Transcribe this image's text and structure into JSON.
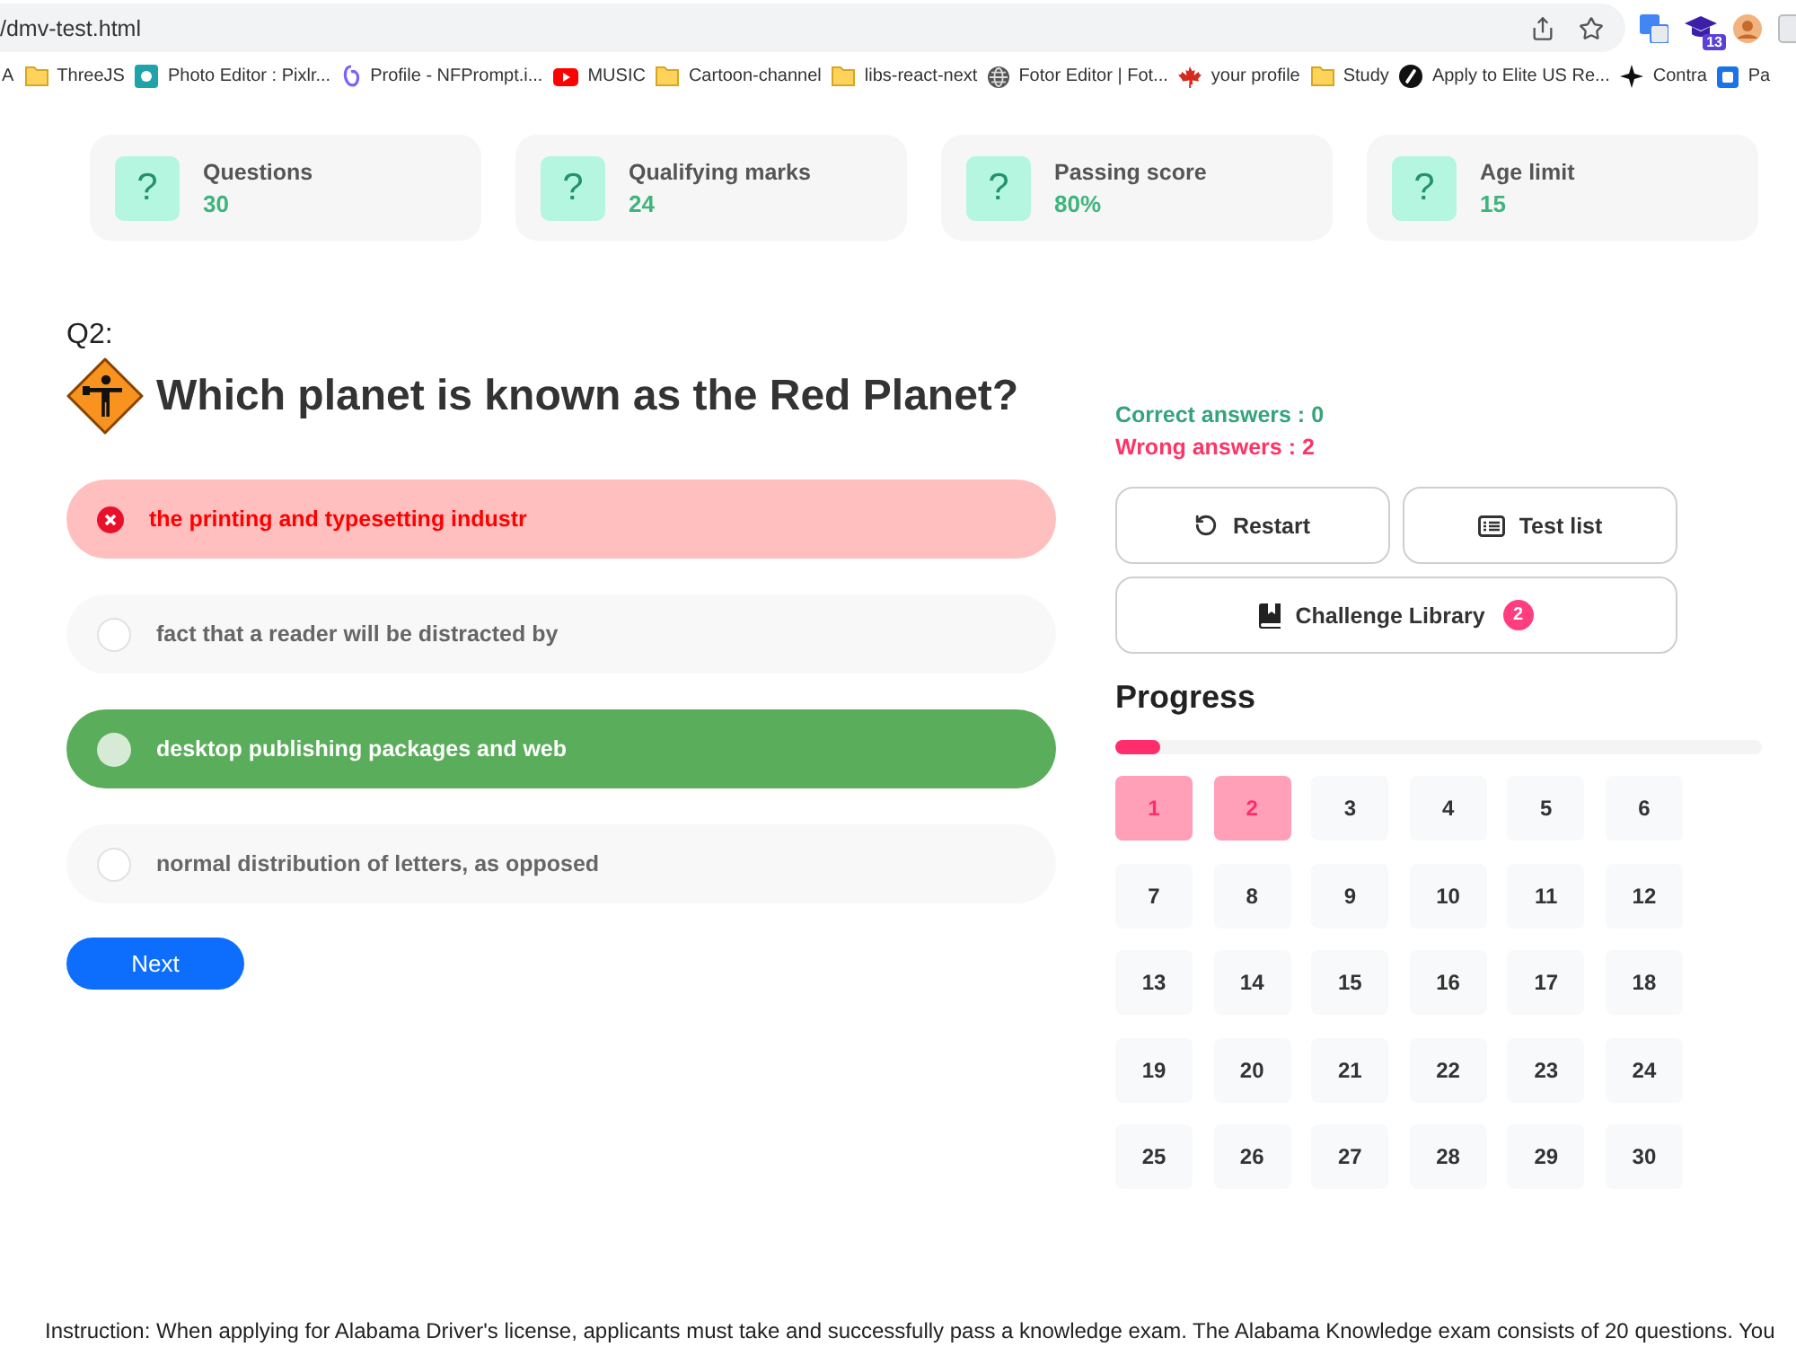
{
  "browser": {
    "url": "/dmv-test.html",
    "extension_badge": "13"
  },
  "bookmarks": [
    {
      "kind": "plain",
      "label": "A"
    },
    {
      "kind": "folder",
      "label": "ThreeJS"
    },
    {
      "kind": "tile",
      "label": "Photo Editor : Pixlr..."
    },
    {
      "kind": "swirl",
      "label": "Profile - NFPrompt.i..."
    },
    {
      "kind": "video",
      "label": "MUSIC"
    },
    {
      "kind": "folder",
      "label": "Cartoon-channel"
    },
    {
      "kind": "folder",
      "label": "libs-react-next"
    },
    {
      "kind": "globe",
      "label": "Fotor Editor | Fot..."
    },
    {
      "kind": "leaf",
      "label": "your profile"
    },
    {
      "kind": "folder",
      "label": "Study"
    },
    {
      "kind": "disc",
      "label": "Apply to Elite US Re..."
    },
    {
      "kind": "diamond",
      "label": "Contra"
    },
    {
      "kind": "square",
      "label": "Pa"
    }
  ],
  "stats": [
    {
      "glyph": "?",
      "label": "Questions",
      "value": "30"
    },
    {
      "glyph": "?",
      "label": "Qualifying marks",
      "value": "24"
    },
    {
      "glyph": "?",
      "label": "Passing score",
      "value": "80%"
    },
    {
      "glyph": "?",
      "label": "Age limit",
      "value": "15"
    }
  ],
  "question": {
    "number": "Q2:",
    "text": "Which planet is known as the Red Planet?"
  },
  "options": [
    {
      "text": "the printing and typesetting industr",
      "selected": true,
      "correct": false
    },
    {
      "text": "fact that a reader will be distracted by",
      "selected": false,
      "correct": false
    },
    {
      "text": "desktop publishing packages and web",
      "selected": false,
      "correct": true
    },
    {
      "text": "normal distribution of letters, as opposed",
      "selected": false,
      "correct": false
    }
  ],
  "next_button": "Next",
  "score": {
    "correct": "Correct answers : 0",
    "wrong": "Wrong answers : 2"
  },
  "actions": [
    {
      "kind": "restart",
      "label": "Restart"
    },
    {
      "kind": "list",
      "label": "Test list"
    },
    {
      "kind": "book",
      "label": "Challenge Library",
      "badge": "2"
    }
  ],
  "progress": {
    "title": "Progress",
    "level": 0.07
  },
  "question_grid": [
    {
      "label": "1",
      "wrong": true
    },
    {
      "label": "2",
      "wrong": true
    },
    {
      "label": "3",
      "wrong": false
    },
    {
      "label": "4",
      "wrong": false
    },
    {
      "label": "5",
      "wrong": false
    },
    {
      "label": "6",
      "wrong": false
    },
    {
      "label": "7",
      "wrong": false
    },
    {
      "label": "8",
      "wrong": false
    },
    {
      "label": "9",
      "wrong": false
    },
    {
      "label": "10",
      "wrong": false
    },
    {
      "label": "11",
      "wrong": false
    },
    {
      "label": "12",
      "wrong": false
    },
    {
      "label": "13",
      "wrong": false
    },
    {
      "label": "14",
      "wrong": false
    },
    {
      "label": "15",
      "wrong": false
    },
    {
      "label": "16",
      "wrong": false
    },
    {
      "label": "17",
      "wrong": false
    },
    {
      "label": "18",
      "wrong": false
    },
    {
      "label": "19",
      "wrong": false
    },
    {
      "label": "20",
      "wrong": false
    },
    {
      "label": "21",
      "wrong": false
    },
    {
      "label": "22",
      "wrong": false
    },
    {
      "label": "23",
      "wrong": false
    },
    {
      "label": "24",
      "wrong": false
    },
    {
      "label": "25",
      "wrong": false
    },
    {
      "label": "26",
      "wrong": false
    },
    {
      "label": "27",
      "wrong": false
    },
    {
      "label": "28",
      "wrong": false
    },
    {
      "label": "29",
      "wrong": false
    },
    {
      "label": "30",
      "wrong": false
    }
  ],
  "instruction": "Instruction: When applying for Alabama Driver's license, applicants must take and successfully pass a knowledge exam. The Alabama Knowledge exam consists of 20 questions. You"
}
